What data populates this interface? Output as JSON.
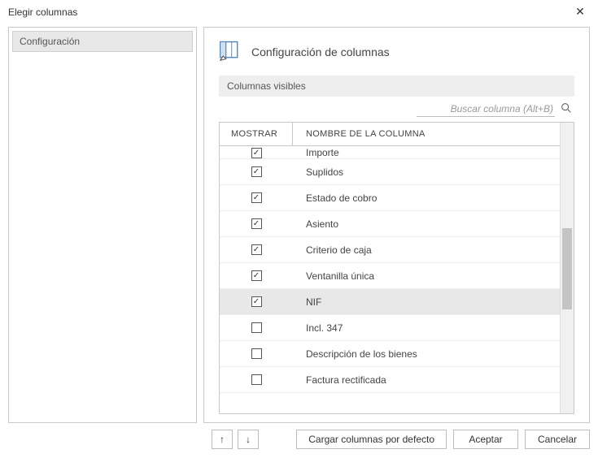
{
  "window": {
    "title": "Elegir columnas"
  },
  "sidebar": {
    "items": [
      {
        "label": "Configuración"
      }
    ]
  },
  "main": {
    "header": "Configuración de columnas",
    "subheader": "Columnas visibles",
    "search": {
      "placeholder": "Buscar columna (Alt+B)"
    },
    "table": {
      "header_mostrar": "MOSTRAR",
      "header_nombre": "NOMBRE DE LA COLUMNA",
      "rows": [
        {
          "label": "Importe",
          "checked": true,
          "selected": false,
          "partial": true
        },
        {
          "label": "Suplidos",
          "checked": true,
          "selected": false
        },
        {
          "label": "Estado de cobro",
          "checked": true,
          "selected": false
        },
        {
          "label": "Asiento",
          "checked": true,
          "selected": false
        },
        {
          "label": "Criterio de caja",
          "checked": true,
          "selected": false
        },
        {
          "label": "Ventanilla única",
          "checked": true,
          "selected": false
        },
        {
          "label": "NIF",
          "checked": true,
          "selected": true
        },
        {
          "label": "Incl. 347",
          "checked": false,
          "selected": false
        },
        {
          "label": "Descripción de los bienes",
          "checked": false,
          "selected": false
        },
        {
          "label": "Factura rectificada",
          "checked": false,
          "selected": false
        }
      ]
    }
  },
  "footer": {
    "load_defaults": "Cargar columnas por defecto",
    "accept": "Aceptar",
    "cancel": "Cancelar"
  }
}
